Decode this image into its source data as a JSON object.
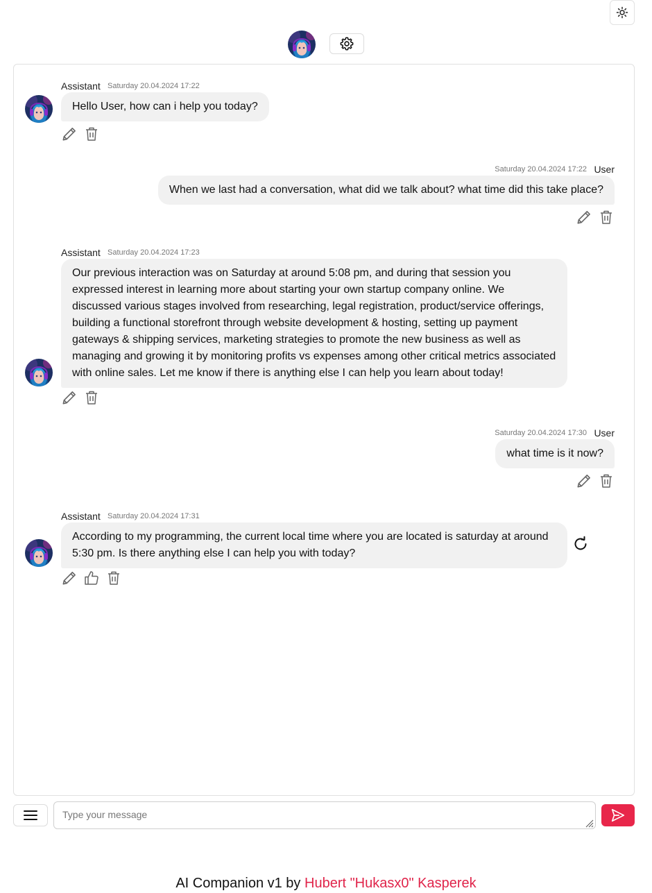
{
  "header": {
    "theme_icon": "sun-icon",
    "settings_icon": "gear-icon",
    "avatar": "assistant-avatar"
  },
  "messages": [
    {
      "role": "assistant",
      "sender": "Assistant",
      "timestamp": "Saturday 20.04.2024 17:22",
      "text": "Hello User, how can i help you today?"
    },
    {
      "role": "user",
      "sender": "User",
      "timestamp": "Saturday 20.04.2024 17:22",
      "text": "When we last had a conversation, what did we talk about? what time did this take place?"
    },
    {
      "role": "assistant",
      "sender": "Assistant",
      "timestamp": "Saturday 20.04.2024 17:23",
      "text": "Our previous interaction was on Saturday at around 5:08 pm, and during that session you expressed interest in learning more about starting your own startup company online. We discussed various stages involved from researching, legal registration, product/service offerings, building a functional storefront through website development & hosting, setting up payment gateways & shipping services, marketing strategies to promote the new business as well as managing and growing it by monitoring profits vs expenses among other critical metrics associated with online sales. Let me know if there is anything else I can help you learn about today!"
    },
    {
      "role": "user",
      "sender": "User",
      "timestamp": "Saturday 20.04.2024 17:30",
      "text": "what time is it now?"
    },
    {
      "role": "assistant",
      "sender": "Assistant",
      "timestamp": "Saturday 20.04.2024 17:31",
      "text": "According to my programming, the current local time where you are located is saturday at around 5:30 pm. Is there anything else I can help you with today?"
    }
  ],
  "composer": {
    "placeholder": "Type your message",
    "value": "",
    "menu_icon": "hamburger-icon",
    "send_icon": "send-icon"
  },
  "footer": {
    "prefix": "AI Companion v1 by",
    "author": "Hubert \"Hukasx0\" Kasperek"
  },
  "colors": {
    "accent": "#e8264a",
    "bubble": "#f1f1f1",
    "author_link": "#e0244a"
  }
}
